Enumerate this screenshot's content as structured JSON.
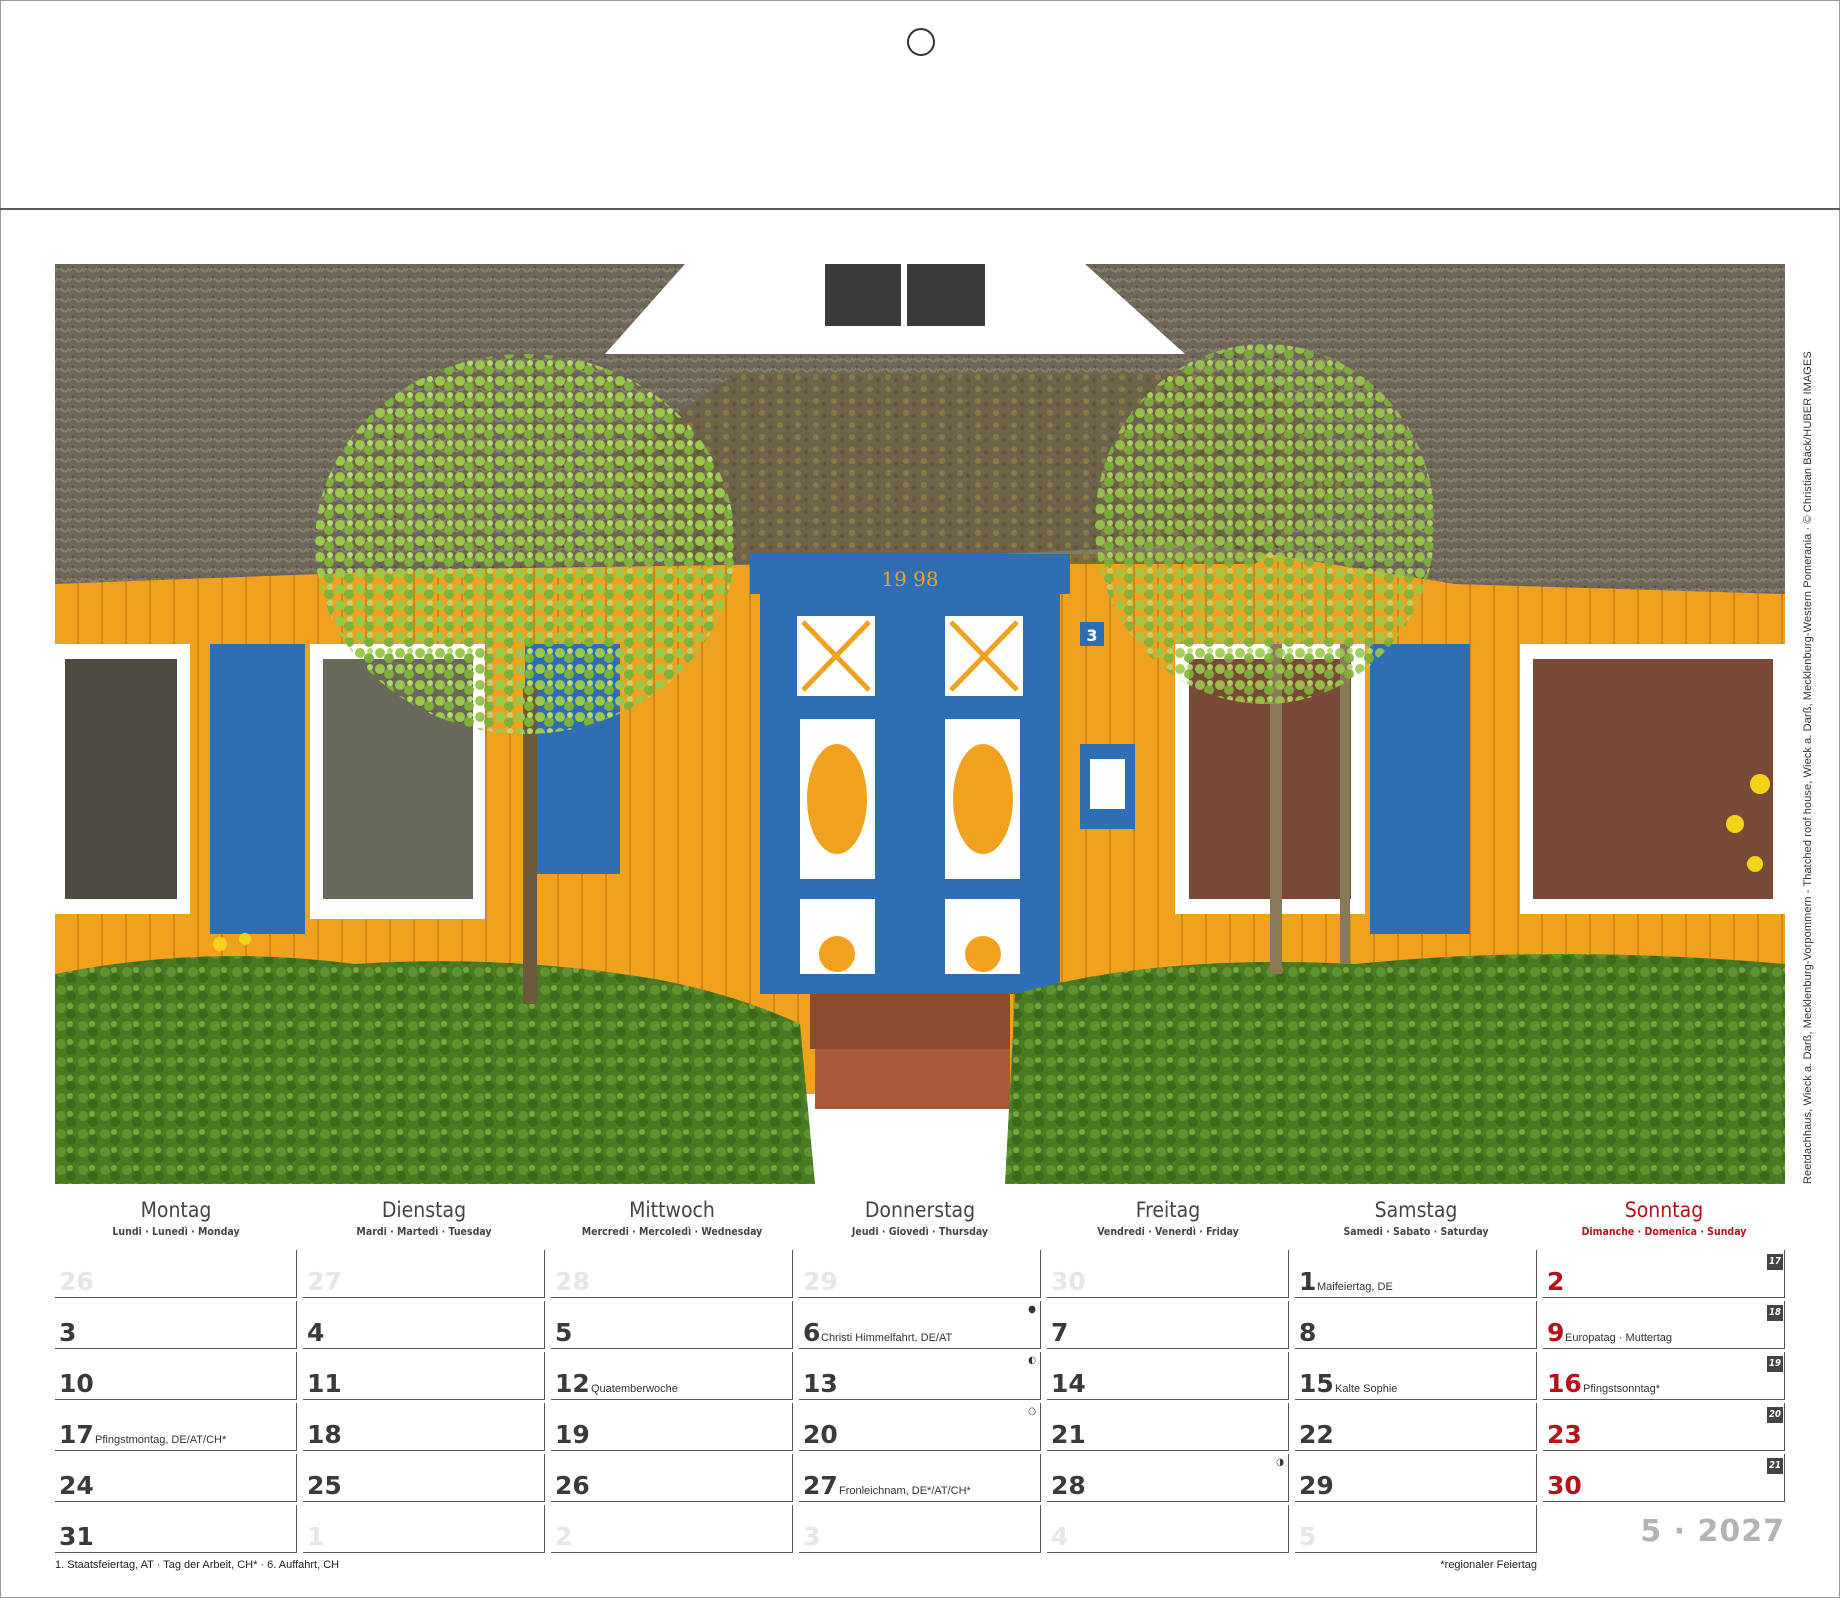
{
  "photo": {
    "caption": "Reetdachhaus, Wieck a. Darß, Mecklenburg-Vorpommern - Thatched roof house, Wieck a. Darß, Mecklenburg-Western Pomerania · © Christian Bäck/HUBER IMAGES",
    "door_year": "19 98",
    "house_number": "3"
  },
  "weekdays": [
    {
      "name": "Montag",
      "sub": "Lundi · Lunedì · Monday"
    },
    {
      "name": "Dienstag",
      "sub": "Mardi · Martedì · Tuesday"
    },
    {
      "name": "Mittwoch",
      "sub": "Mercredi · Mercoledì · Wednesday"
    },
    {
      "name": "Donnerstag",
      "sub": "Jeudi · Giovedì · Thursday"
    },
    {
      "name": "Freitag",
      "sub": "Vendredi · Venerdì · Friday"
    },
    {
      "name": "Samstag",
      "sub": "Samedi · Sabato · Saturday"
    },
    {
      "name": "Sonntag",
      "sub": "Dimanche · Domenica · Sunday"
    }
  ],
  "weeks": [
    {
      "week_no": "17",
      "days": [
        {
          "num": "26",
          "other": true
        },
        {
          "num": "27",
          "other": true
        },
        {
          "num": "28",
          "other": true
        },
        {
          "num": "29",
          "other": true
        },
        {
          "num": "30",
          "other": true
        },
        {
          "num": "1",
          "note": "Maifeiertag, DE"
        },
        {
          "num": "2",
          "red": true
        }
      ]
    },
    {
      "week_no": "18",
      "days": [
        {
          "num": "3"
        },
        {
          "num": "4"
        },
        {
          "num": "5"
        },
        {
          "num": "6",
          "note": "Christi Himmelfahrt, DE/AT",
          "moon": "●"
        },
        {
          "num": "7"
        },
        {
          "num": "8"
        },
        {
          "num": "9",
          "red": true,
          "note": "Europatag · Muttertag"
        }
      ]
    },
    {
      "week_no": "19",
      "days": [
        {
          "num": "10"
        },
        {
          "num": "11"
        },
        {
          "num": "12",
          "note": "Quatemberwoche"
        },
        {
          "num": "13",
          "moon": "◐"
        },
        {
          "num": "14"
        },
        {
          "num": "15",
          "note": "Kalte Sophie"
        },
        {
          "num": "16",
          "red": true,
          "note": "Pfingstsonntag*"
        }
      ]
    },
    {
      "week_no": "20",
      "days": [
        {
          "num": "17",
          "note": "Pfingstmontag, DE/AT/CH*"
        },
        {
          "num": "18"
        },
        {
          "num": "19"
        },
        {
          "num": "20",
          "moon": "○"
        },
        {
          "num": "21"
        },
        {
          "num": "22"
        },
        {
          "num": "23",
          "red": true
        }
      ]
    },
    {
      "week_no": "21",
      "days": [
        {
          "num": "24"
        },
        {
          "num": "25"
        },
        {
          "num": "26"
        },
        {
          "num": "27",
          "note": "Fronleichnam, DE*/AT/CH*"
        },
        {
          "num": "28",
          "moon": "◑"
        },
        {
          "num": "29"
        },
        {
          "num": "30",
          "red": true
        }
      ]
    },
    {
      "week_no": "",
      "days": [
        {
          "num": "31"
        },
        {
          "num": "1",
          "other": true
        },
        {
          "num": "2",
          "other": true
        },
        {
          "num": "3",
          "other": true
        },
        {
          "num": "4",
          "other": true
        },
        {
          "num": "5",
          "other": true
        }
      ]
    }
  ],
  "month_year": "5 · 2027",
  "footnote_left": "1. Staatsfeiertag, AT · Tag der Arbeit, CH* · 6. Auffahrt, CH",
  "footnote_right": "*regionaler Feiertag",
  "colors": {
    "sunday_red": "#b5121b",
    "grid_line": "#555555",
    "faded_number": "#e6e6e6"
  }
}
